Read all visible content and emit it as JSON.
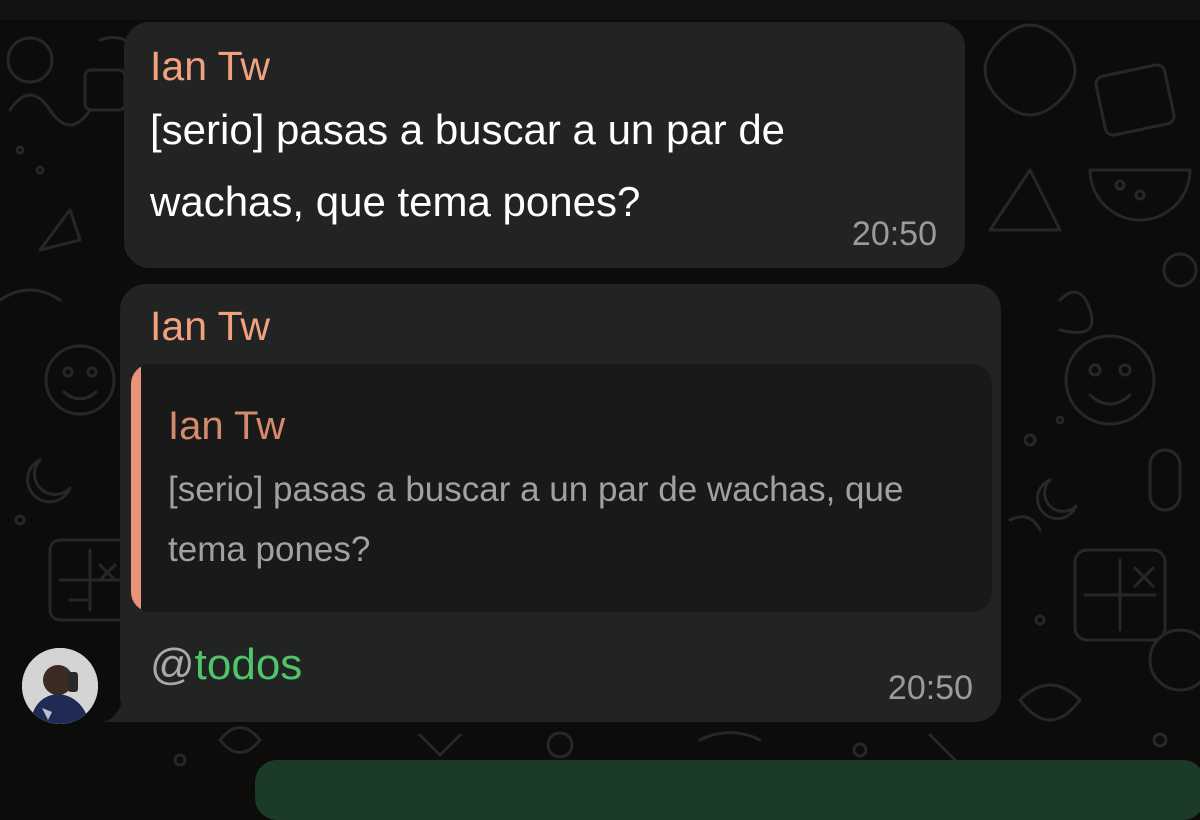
{
  "colors": {
    "background": "#0c0c0b",
    "bubble": "#222423",
    "quote_background": "#181918",
    "sender_name": "#f3a07e",
    "quote_accent": "#e8947a",
    "mention": "#4fc46b",
    "timestamp": "#9a9b9a",
    "outgoing_bubble": "#1b3a28"
  },
  "messages": [
    {
      "sender": "Ian Tw",
      "text": "[serio] pasas a buscar a un par de wachas, que tema pones?",
      "time": "20:50"
    },
    {
      "sender": "Ian Tw",
      "reply_to": {
        "sender": "Ian Tw",
        "text": "[serio] pasas a buscar a un par de wachas, que tema pones?"
      },
      "mention": {
        "at": "@",
        "name": "todos"
      },
      "time": "20:50"
    }
  ],
  "icons": {
    "avatar": "sender-avatar-photo",
    "wallpaper": "chat-doodle-pattern"
  }
}
